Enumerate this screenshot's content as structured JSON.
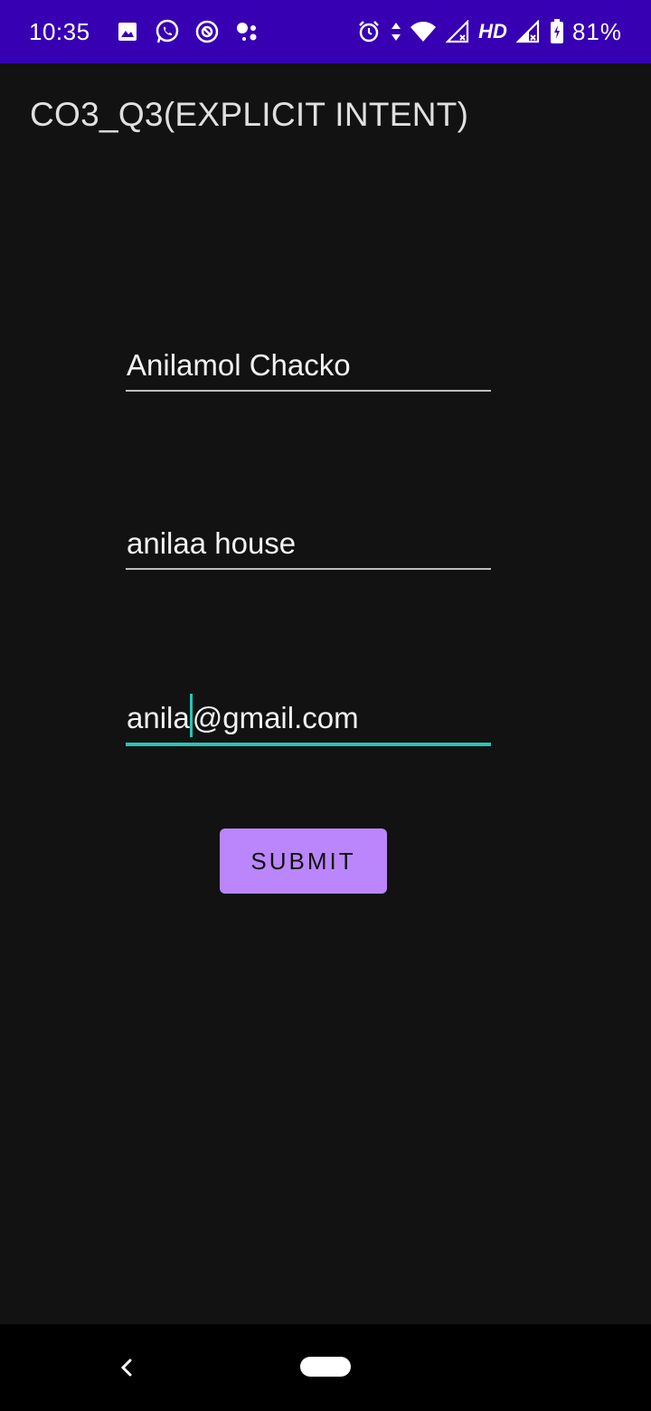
{
  "status_bar": {
    "time": "10:35",
    "hd": "HD",
    "battery": "81%",
    "background": "#3700b3",
    "left_icons": [
      "image-icon",
      "whatsapp-icon",
      "vpn-icon",
      "assistant-icon"
    ],
    "right_icons": [
      "alarm-icon",
      "data-arrows-icon",
      "wifi-icon",
      "signal-icon",
      "signal-icon-2",
      "battery-icon"
    ]
  },
  "app": {
    "title": "CO3_Q3(EXPLICIT INTENT)"
  },
  "form": {
    "name_value": "Anilamol Chacko",
    "address_value": "anilaa house",
    "email_value_before_caret": "anila",
    "email_value_after_caret": "@gmail.com",
    "submit_label": "SUBMIT",
    "accent": "#26c6b5",
    "button_color": "#bb86fc"
  },
  "nav": {
    "back_icon": "back-icon",
    "home_icon": "home-pill-icon"
  }
}
